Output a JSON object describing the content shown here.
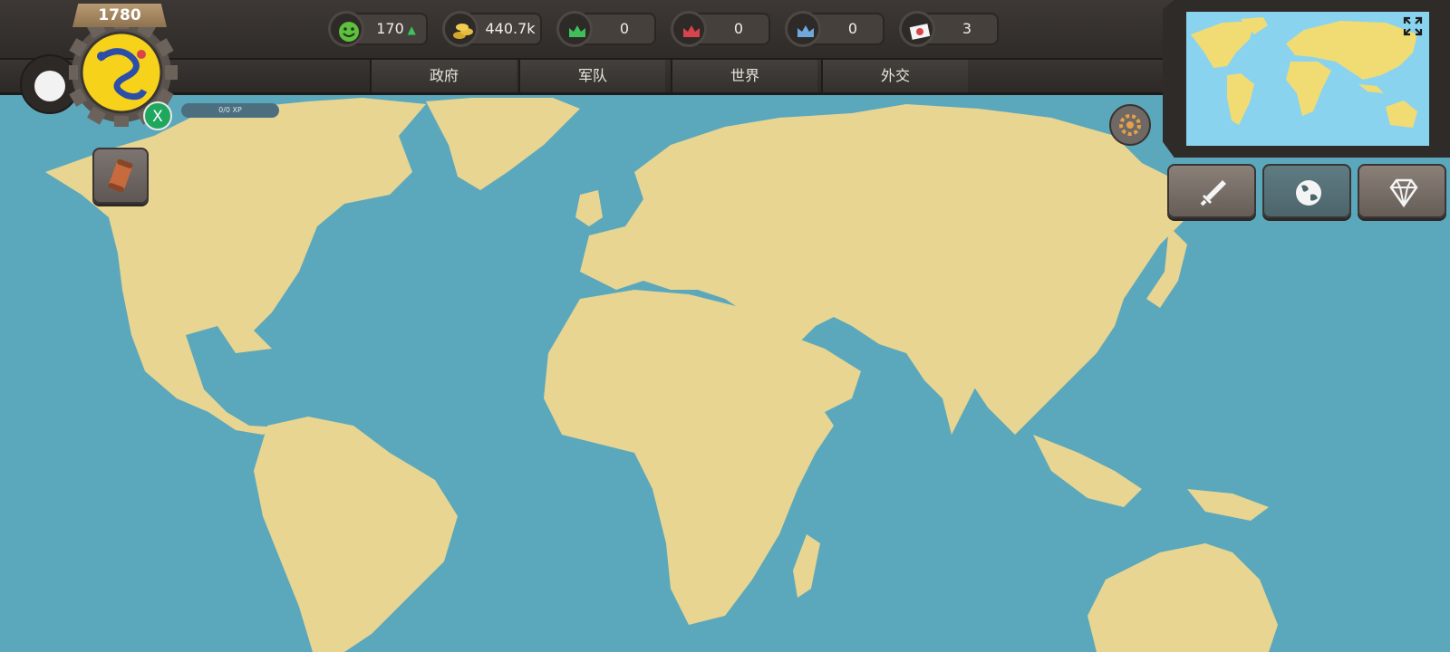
{
  "header": {
    "year": "1780",
    "resources": [
      {
        "id": "happiness",
        "icon": "smiley-icon",
        "value": "170",
        "trend": "up"
      },
      {
        "id": "gold",
        "icon": "coins-icon",
        "value": "440.7k",
        "trend": "up"
      },
      {
        "id": "green-crown",
        "icon": "green-crown-icon",
        "value": "0"
      },
      {
        "id": "red-crown",
        "icon": "red-crown-icon",
        "value": "0"
      },
      {
        "id": "blue-crown",
        "icon": "blue-crown-icon",
        "value": "0"
      },
      {
        "id": "flag",
        "icon": "japan-flag-icon",
        "value": "3"
      }
    ]
  },
  "menu": {
    "tabs": [
      {
        "id": "government",
        "label": "政府"
      },
      {
        "id": "army",
        "label": "军队"
      },
      {
        "id": "world",
        "label": "世界"
      },
      {
        "id": "diplomacy",
        "label": "外交"
      }
    ]
  },
  "player": {
    "badge_label": "X",
    "xp_label": "0/0 XP",
    "xp_progress": 0
  },
  "side_buttons": [
    {
      "id": "sword",
      "icon": "sword-icon"
    },
    {
      "id": "globe",
      "icon": "globe-icon"
    },
    {
      "id": "diamond",
      "icon": "diamond-icon"
    }
  ],
  "colors": {
    "ocean": "#5ba8bd",
    "land": "#e8d591",
    "minimap_ocean": "#8ad3ee",
    "minimap_land": "#f1dc74",
    "ui_dark": "#2f2b28",
    "positive": "#3ec35a"
  }
}
